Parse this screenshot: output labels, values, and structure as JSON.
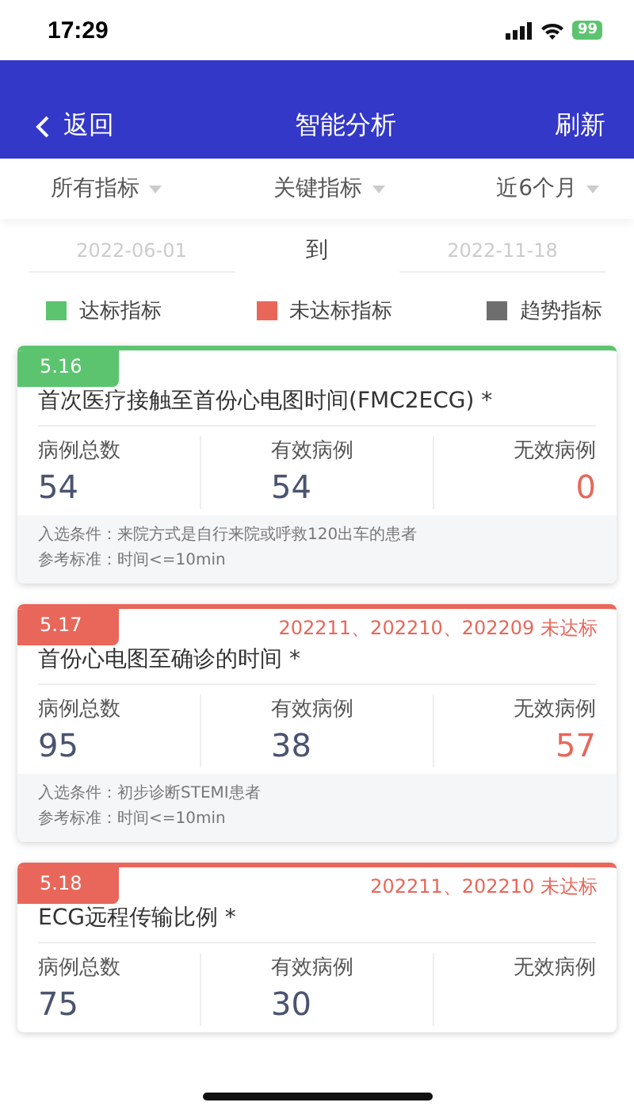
{
  "status_bar": {
    "time": "17:29",
    "battery": "99"
  },
  "header": {
    "back": "返回",
    "title": "智能分析",
    "action": "刷新"
  },
  "filters": [
    {
      "label": "所有指标"
    },
    {
      "label": "关键指标"
    },
    {
      "label": "近6个月"
    }
  ],
  "date_range": {
    "start": "2022-06-01",
    "separator": "到",
    "end": "2022-11-18"
  },
  "legend": [
    {
      "label": "达标指标",
      "color": "#5cc46f"
    },
    {
      "label": "未达标指标",
      "color": "#e8675a"
    },
    {
      "label": "趋势指标",
      "color": "#6e6e6e"
    }
  ],
  "cards": [
    {
      "code": "5.16",
      "color": "#5cc46f",
      "title": "首次医疗接触至首份心电图时间(FMC2ECG) *",
      "stats": [
        {
          "label": "病例总数",
          "value": "54",
          "kind": "normal"
        },
        {
          "label": "有效病例",
          "value": "54",
          "kind": "normal"
        },
        {
          "label": "无效病例",
          "value": "0",
          "kind": "invalid"
        }
      ],
      "criteria": [
        "入选条件：来院方式是自行来院或呼救120出车的患者",
        "参考标准：时间<=10min"
      ]
    },
    {
      "code": "5.17",
      "color": "#e8675a",
      "alert": "202211、202210、202209 未达标",
      "title": "首份心电图至确诊的时间 *",
      "stats": [
        {
          "label": "病例总数",
          "value": "95",
          "kind": "normal"
        },
        {
          "label": "有效病例",
          "value": "38",
          "kind": "normal"
        },
        {
          "label": "无效病例",
          "value": "57",
          "kind": "invalid"
        }
      ],
      "criteria": [
        "入选条件：初步诊断STEMI患者",
        "参考标准：时间<=10min"
      ]
    },
    {
      "code": "5.18",
      "color": "#e8675a",
      "alert": "202211、202210 未达标",
      "title": "ECG远程传输比例 *",
      "stats": [
        {
          "label": "病例总数",
          "value": "75",
          "kind": "normal"
        },
        {
          "label": "有效病例",
          "value": "30",
          "kind": "normal"
        },
        {
          "label": "无效病例"
        }
      ]
    }
  ]
}
